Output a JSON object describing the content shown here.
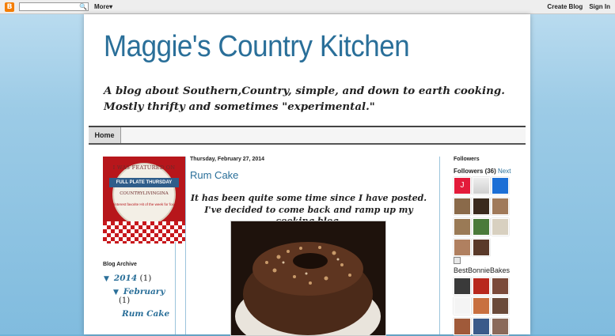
{
  "navbar": {
    "logo_letter": "B",
    "search_icon": "magnifier-icon",
    "search_glyph": "🔍",
    "more_label": "More",
    "more_caret": "▾",
    "create_blog": "Create Blog",
    "sign_in": "Sign In"
  },
  "header": {
    "title": "Maggie's Country Kitchen",
    "description": "A blog about Southern,Country, simple, and down to earth cooking. Mostly thrifty and sometimes \"experimental.\""
  },
  "tabs": [
    {
      "label": "Home"
    }
  ],
  "badge": {
    "line1": "I WAS FEATURED ON",
    "line2": "FULL PLATE THURSDAY",
    "line3": "COUNTRYLIVINGINA",
    "line4": "Pinterest favorite Hit of the week for food"
  },
  "archive": {
    "title": "Blog Archive",
    "year": "2014",
    "year_count": "(1)",
    "month": "February",
    "month_count": "(1)",
    "post": "Rum Cake"
  },
  "post": {
    "date": "Thursday, February 27, 2014",
    "title": "Rum Cake",
    "body": "It has been quite some time since I have posted. I've decided to come back and ramp up my cooking blog."
  },
  "followers": {
    "title": "Followers",
    "label": "Followers (36)",
    "next": "Next",
    "letter_avatar": "J",
    "broken_name": "BestBonnieBakes"
  },
  "colors": {
    "link": "#2a6f99",
    "background": "#7fbbde",
    "badge_red": "#b7161b"
  }
}
